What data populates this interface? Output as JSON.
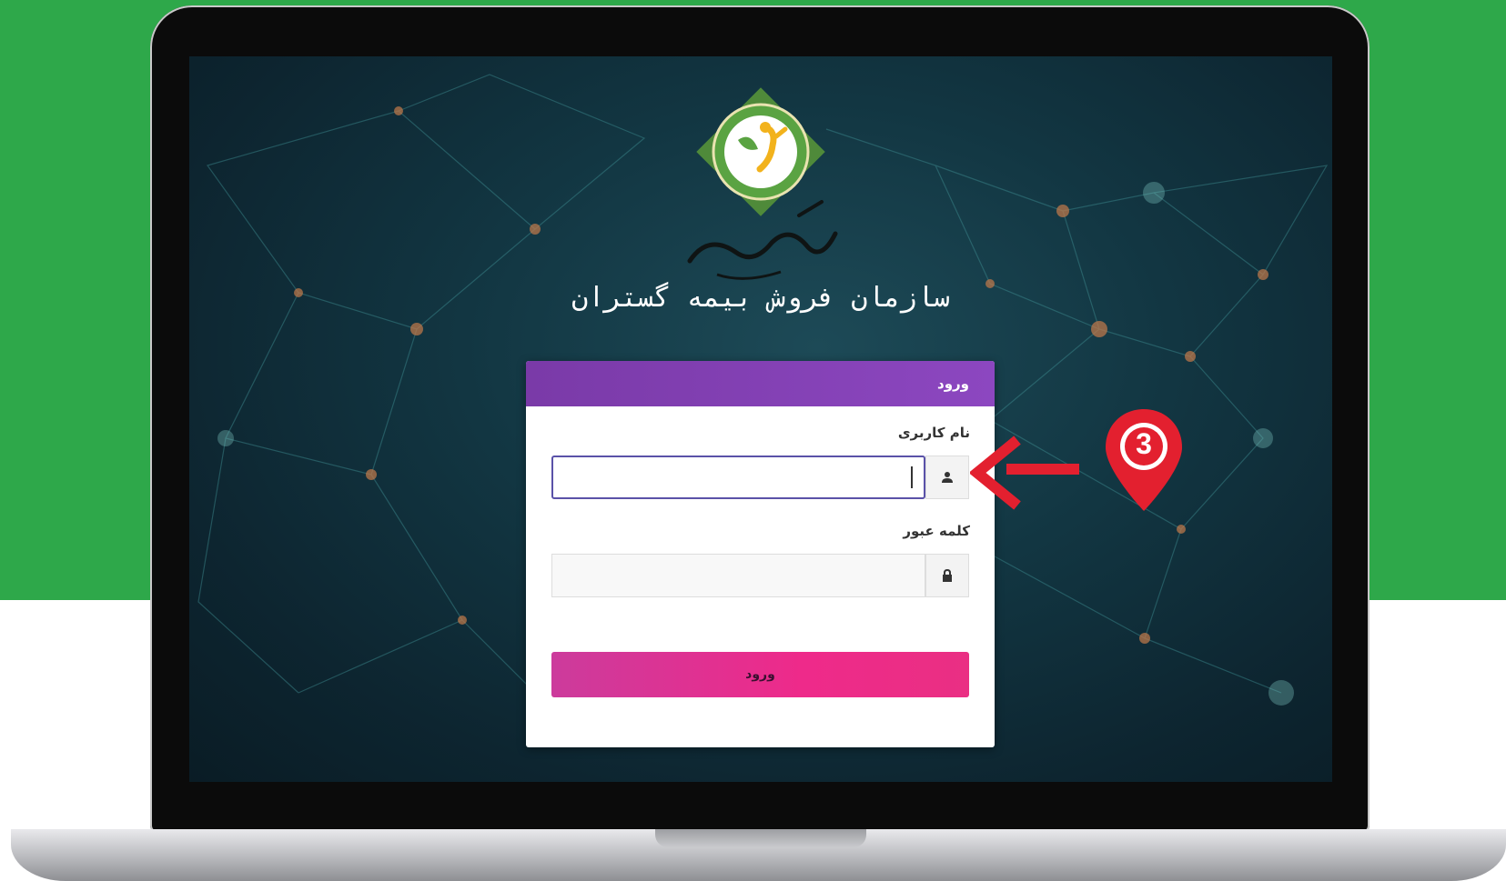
{
  "screen": {
    "org_title": "سازمان فروش بیمه گستران",
    "logo_script_text": "بیمه گستران"
  },
  "login": {
    "header_title": "ورود",
    "username_label": "نام کاربری",
    "username_value": "",
    "password_label": "کلمه عبور",
    "password_value": "",
    "submit_label": "ورود"
  },
  "annotation": {
    "step_number": "3"
  },
  "colors": {
    "page_green": "#2ea84a",
    "card_header_purple": "#7a3aa8",
    "button_pink": "#ee2a8a",
    "annotation_red": "#e3202f"
  },
  "icons": {
    "username": "user-icon",
    "password": "lock-icon"
  }
}
